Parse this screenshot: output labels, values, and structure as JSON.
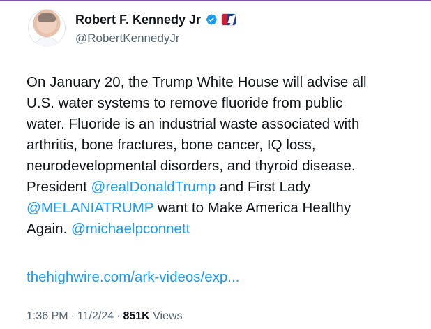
{
  "user": {
    "display_name": "Robert F. Kennedy Jr",
    "handle": "@RobertKennedyJr",
    "verified_icon": "verified-badge-icon",
    "affiliation_icon": "campaign-badge-icon"
  },
  "tweet": {
    "lines": [
      [
        {
          "text": "On January 20, the Trump White House will advise all"
        }
      ],
      [
        {
          "text": "U.S. water systems to remove fluoride from public"
        }
      ],
      [
        {
          "text": "water. Fluoride is an industrial waste associated with"
        }
      ],
      [
        {
          "text": "arthritis, bone fractures, bone cancer, IQ loss,"
        }
      ],
      [
        {
          "text": "neurodevelopmental disorders, and thyroid disease."
        }
      ],
      [
        {
          "text": "President "
        },
        {
          "text": "@realDonaldTrump",
          "mention": true
        },
        {
          "text": " and First Lady"
        }
      ],
      [
        {
          "text": "@MELANIATRUMP",
          "mention": true
        },
        {
          "text": " want to Make America Healthy"
        }
      ],
      [
        {
          "text": "Again. "
        },
        {
          "text": "@michaelpconnett",
          "mention": true
        }
      ]
    ],
    "link": "thehighwire.com/ark-videos/exp..."
  },
  "meta": {
    "time": "1:36 PM",
    "date": "11/2/24",
    "views_count": "851K",
    "views_label": "Views",
    "separator": "·"
  },
  "colors": {
    "link": "#1d9bf0",
    "secondary_text": "#536471",
    "primary_text": "#0f1419",
    "top_rule": "#7a5aa8"
  }
}
